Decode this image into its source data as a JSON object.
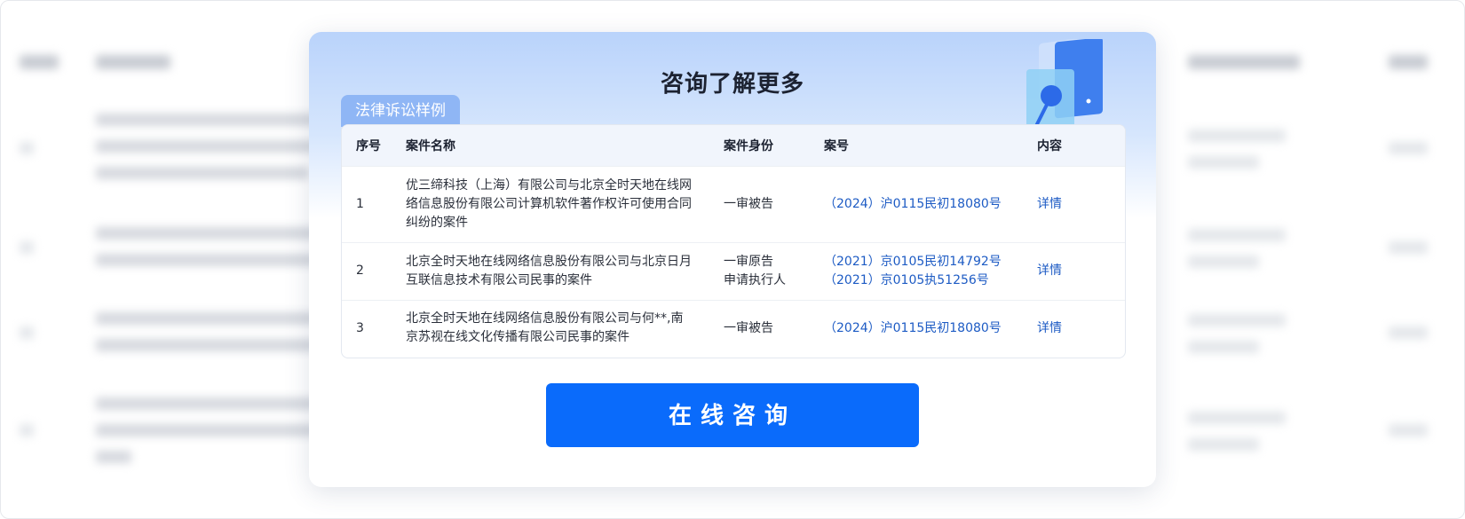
{
  "modal": {
    "title": "咨询了解更多",
    "tab_label": "法律诉讼样例",
    "columns": [
      "序号",
      "案件名称",
      "案件身份",
      "案号",
      "内容"
    ],
    "rows": [
      {
        "index": "1",
        "name": "优三缔科技（上海）有限公司与北京全时天地在线网络信息股份有限公司计算机软件著作权许可使用合同纠纷的案件",
        "roles": [
          "一审被告"
        ],
        "case_numbers": [
          "（2024）沪0115民初18080号"
        ],
        "action": "详情"
      },
      {
        "index": "2",
        "name": "北京全时天地在线网络信息股份有限公司与北京日月互联信息技术有限公司民事的案件",
        "roles": [
          "一审原告",
          "申请执行人"
        ],
        "case_numbers": [
          "（2021）京0105民初14792号",
          "（2021）京0105执51256号"
        ],
        "action": "详情"
      },
      {
        "index": "3",
        "name": "北京全时天地在线网络信息股份有限公司与何**,南京苏视在线文化传播有限公司民事的案件",
        "roles": [
          "一审被告"
        ],
        "case_numbers": [
          "（2024）沪0115民初18080号"
        ],
        "action": "详情"
      }
    ],
    "cta_label": "在线咨询"
  },
  "colors": {
    "primary": "#0a6bfb",
    "link": "#1d5bc4",
    "tab": "#8fb6f5",
    "header_gradient_top": "#b9d3fb"
  }
}
